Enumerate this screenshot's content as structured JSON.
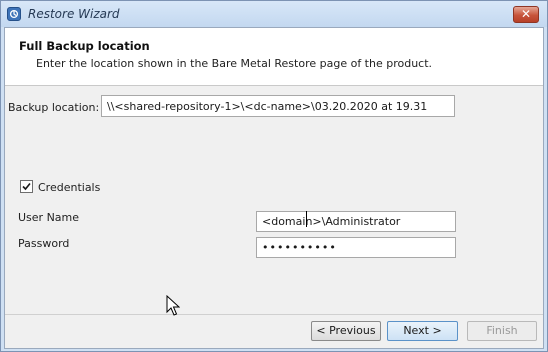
{
  "window": {
    "title": "Restore Wizard",
    "close_symbol": "✕"
  },
  "header": {
    "title": "Full Backup location",
    "subtitle": "Enter the location shown in the Bare Metal Restore page of the product."
  },
  "backup_location": {
    "label": "Backup location:",
    "value": "\\\\<shared-repository-1>\\<dc-name>\\03.20.2020 at 19.31"
  },
  "credentials": {
    "label": "Credentials",
    "checked": true
  },
  "user_name": {
    "label": "User Name",
    "value": "<domain>\\Administrator"
  },
  "password": {
    "label": "Password",
    "value": "••••••••••"
  },
  "buttons": {
    "previous": "< Previous",
    "next": "Next >",
    "finish": "Finish"
  },
  "icons": {
    "app": "wizard-app-icon",
    "close": "close-icon",
    "checkbox": "checkmark-icon",
    "pointer": "mouse-pointer-icon"
  }
}
